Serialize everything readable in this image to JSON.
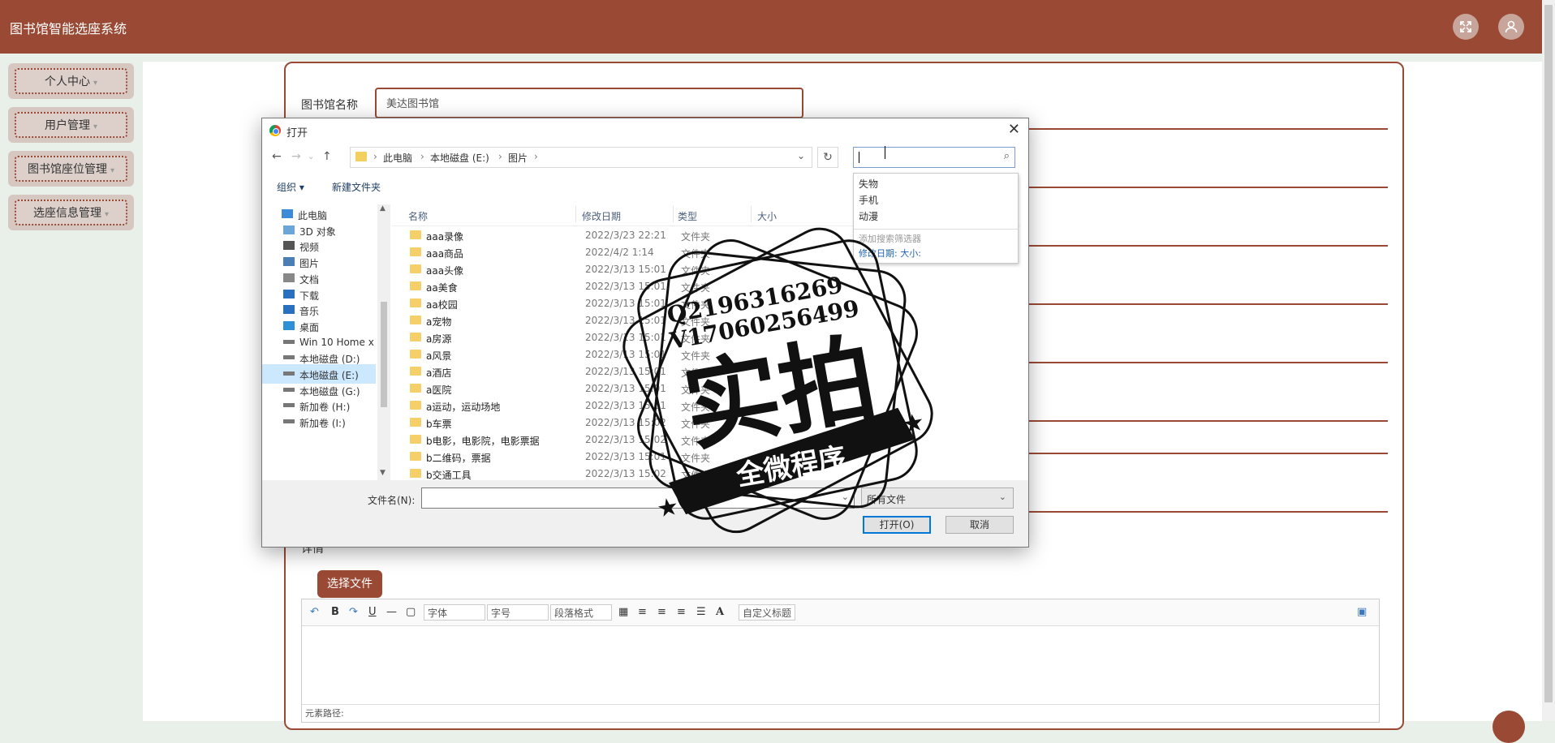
{
  "app": {
    "title": "图书馆智能选座系统"
  },
  "sidebar": {
    "items": [
      {
        "label": "个人中心"
      },
      {
        "label": "用户管理"
      },
      {
        "label": "图书馆座位管理"
      },
      {
        "label": "选座信息管理"
      }
    ]
  },
  "form": {
    "name_label": "图书馆名称",
    "name_value": "美达图书馆",
    "detail_label": "详情",
    "select_file_label": "选择文件"
  },
  "editor": {
    "toolbar": {
      "bold": "B",
      "underline": "U",
      "font_family": "字体",
      "font_size": "字号",
      "paragraph": "段落格式",
      "font_color": "A",
      "custom_title": "自定义标题"
    },
    "path_label": "元素路径:"
  },
  "dialog": {
    "title": "打开",
    "address": [
      "此电脑",
      "本地磁盘 (E:)",
      "图片"
    ],
    "organize": "组织",
    "new_folder": "新建文件夹",
    "nav_items": [
      {
        "label": "此电脑",
        "icon": "computer-icon"
      },
      {
        "label": "3D 对象",
        "icon": "cube-icon"
      },
      {
        "label": "视频",
        "icon": "video-icon"
      },
      {
        "label": "图片",
        "icon": "picture-icon"
      },
      {
        "label": "文档",
        "icon": "document-icon"
      },
      {
        "label": "下载",
        "icon": "download-icon"
      },
      {
        "label": "音乐",
        "icon": "music-icon"
      },
      {
        "label": "桌面",
        "icon": "desktop-icon"
      },
      {
        "label": "Win 10 Home x",
        "icon": "drive-icon"
      },
      {
        "label": "本地磁盘 (D:)",
        "icon": "drive-icon"
      },
      {
        "label": "本地磁盘 (E:)",
        "icon": "drive-icon",
        "selected": true
      },
      {
        "label": "本地磁盘 (G:)",
        "icon": "drive-icon"
      },
      {
        "label": "新加卷 (H:)",
        "icon": "drive-icon"
      },
      {
        "label": "新加卷 (I:)",
        "icon": "drive-icon"
      }
    ],
    "columns": [
      "名称",
      "修改日期",
      "类型",
      "大小"
    ],
    "files": [
      {
        "name": "aaa录像",
        "date": "2022/3/23 22:21",
        "type": "文件夹"
      },
      {
        "name": "aaa商品",
        "date": "2022/4/2 1:14",
        "type": "文件夹"
      },
      {
        "name": "aaa头像",
        "date": "2022/3/13 15:01",
        "type": "文件夹"
      },
      {
        "name": "aa美食",
        "date": "2022/3/13 15:01",
        "type": "文件夹"
      },
      {
        "name": "aa校园",
        "date": "2022/3/13 15:01",
        "type": "文件夹"
      },
      {
        "name": "a宠物",
        "date": "2022/3/13 15:01",
        "type": "文件夹"
      },
      {
        "name": "a房源",
        "date": "2022/3/13 15:01",
        "type": "文件夹"
      },
      {
        "name": "a风景",
        "date": "2022/3/13 15:01",
        "type": "文件夹"
      },
      {
        "name": "a酒店",
        "date": "2022/3/13 15:01",
        "type": "文件夹"
      },
      {
        "name": "a医院",
        "date": "2022/3/13 15:01",
        "type": "文件夹"
      },
      {
        "name": "a运动，运动场地",
        "date": "2022/3/13 15:01",
        "type": "文件夹"
      },
      {
        "name": "b车票",
        "date": "2022/3/13 15:02",
        "type": "文件夹"
      },
      {
        "name": "b电影，电影院，电影票据",
        "date": "2022/3/13 15:02",
        "type": "文件夹"
      },
      {
        "name": "b二维码，票据",
        "date": "2022/3/13 15:01",
        "type": "文件夹"
      },
      {
        "name": "b交通工具",
        "date": "2022/3/13 15:02",
        "type": "文件夹"
      }
    ],
    "file_name_label": "文件名(N):",
    "file_name_value": "",
    "file_type": "所有文件",
    "open_button": "打开(O)",
    "cancel_button": "取消",
    "search_value": "",
    "suggestions": [
      "失物",
      "手机",
      "动漫"
    ],
    "filter_hint": "添加搜索筛选器",
    "filter_links": "修改日期:  大小:"
  },
  "watermark": {
    "line1": "Q2196316269",
    "line2": "V17060256499",
    "main": "实拍",
    "banner": "全微程序"
  },
  "colors": {
    "brand": "#9a4a34",
    "accent": "#0078d7"
  }
}
